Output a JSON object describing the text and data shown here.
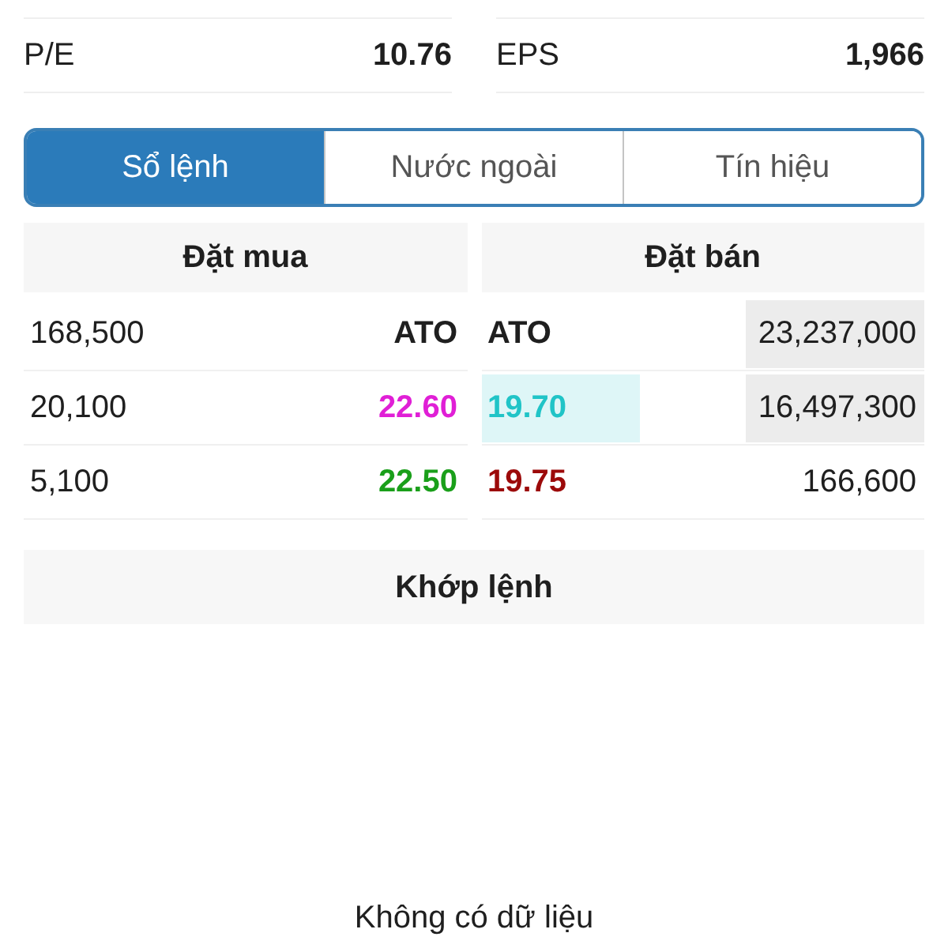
{
  "stats": [
    {
      "label": "P/E",
      "value": "10.76"
    },
    {
      "label": "EPS",
      "value": "1,966"
    }
  ],
  "tabs": [
    {
      "label": "Sổ lệnh",
      "selected": true
    },
    {
      "label": "Nước ngoài",
      "selected": false
    },
    {
      "label": "Tín hiệu",
      "selected": false
    }
  ],
  "order_book": {
    "bid_title": "Đặt mua",
    "ask_title": "Đặt bán",
    "rows": [
      {
        "bid": {
          "volume": "168,500",
          "price": "ATO",
          "color": "#1f1f1f"
        },
        "ask": {
          "price": "ATO",
          "color": "#1f1f1f",
          "price_highlighted": false,
          "volume": "23,237,000",
          "volume_highlighted": true
        }
      },
      {
        "bid": {
          "volume": "20,100",
          "price": "22.60",
          "color": "#e01fd6"
        },
        "ask": {
          "price": "19.70",
          "color": "#20c4c7",
          "price_highlighted": true,
          "volume": "16,497,300",
          "volume_highlighted": true
        }
      },
      {
        "bid": {
          "volume": "5,100",
          "price": "22.50",
          "color": "#1a9f1a"
        },
        "ask": {
          "price": "19.75",
          "color": "#9c0a0a",
          "price_highlighted": false,
          "volume": "166,600",
          "volume_highlighted": false
        }
      }
    ]
  },
  "matched": {
    "title": "Khớp lệnh",
    "empty_text": "Không có dữ liệu"
  }
}
